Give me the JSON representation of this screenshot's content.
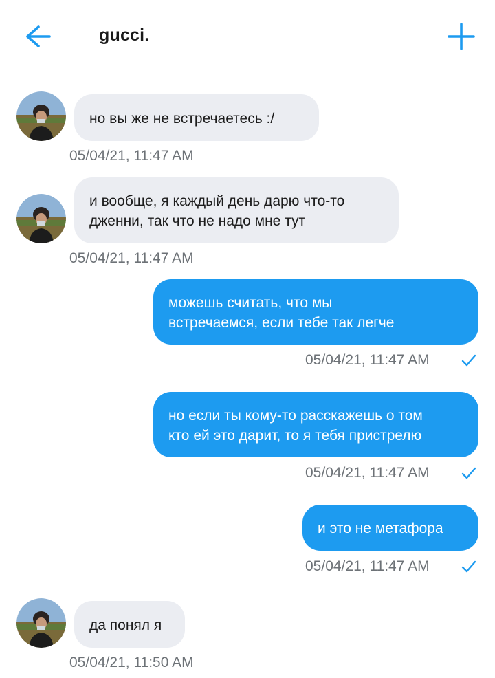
{
  "header": {
    "title": "gucci.",
    "back_icon": "arrow-left-icon",
    "add_icon": "plus-icon",
    "accent": "#1d9bf0"
  },
  "messages": [
    {
      "direction": "incoming",
      "text": "но вы же не встречаетесь :/",
      "time": "05/04/21, 11:47 AM"
    },
    {
      "direction": "incoming",
      "lines": [
        "и вообще, я каждый день дарю что-то",
        "дженни, так что не надо мне тут"
      ],
      "time": "05/04/21, 11:47 AM"
    },
    {
      "direction": "outgoing",
      "lines": [
        "можешь считать, что мы",
        "встречаемся, если тебе так легче"
      ],
      "time": "05/04/21, 11:47 AM",
      "status_icon": "checkmark-icon"
    },
    {
      "direction": "outgoing",
      "lines": [
        "но если ты кому-то расскажешь о том",
        "кто ей это дарит, то я тебя пристрелю"
      ],
      "time": "05/04/21, 11:47 AM",
      "status_icon": "checkmark-icon"
    },
    {
      "direction": "outgoing",
      "text": "и это не метафора",
      "time": "05/04/21, 11:47 AM",
      "status_icon": "checkmark-icon"
    },
    {
      "direction": "incoming",
      "text": "да понял я",
      "time": "05/04/21, 11:50 AM"
    }
  ],
  "colors": {
    "outgoing_bubble": "#1d9bf0",
    "incoming_bubble": "#ebedf2",
    "timestamp": "#6d7277"
  }
}
